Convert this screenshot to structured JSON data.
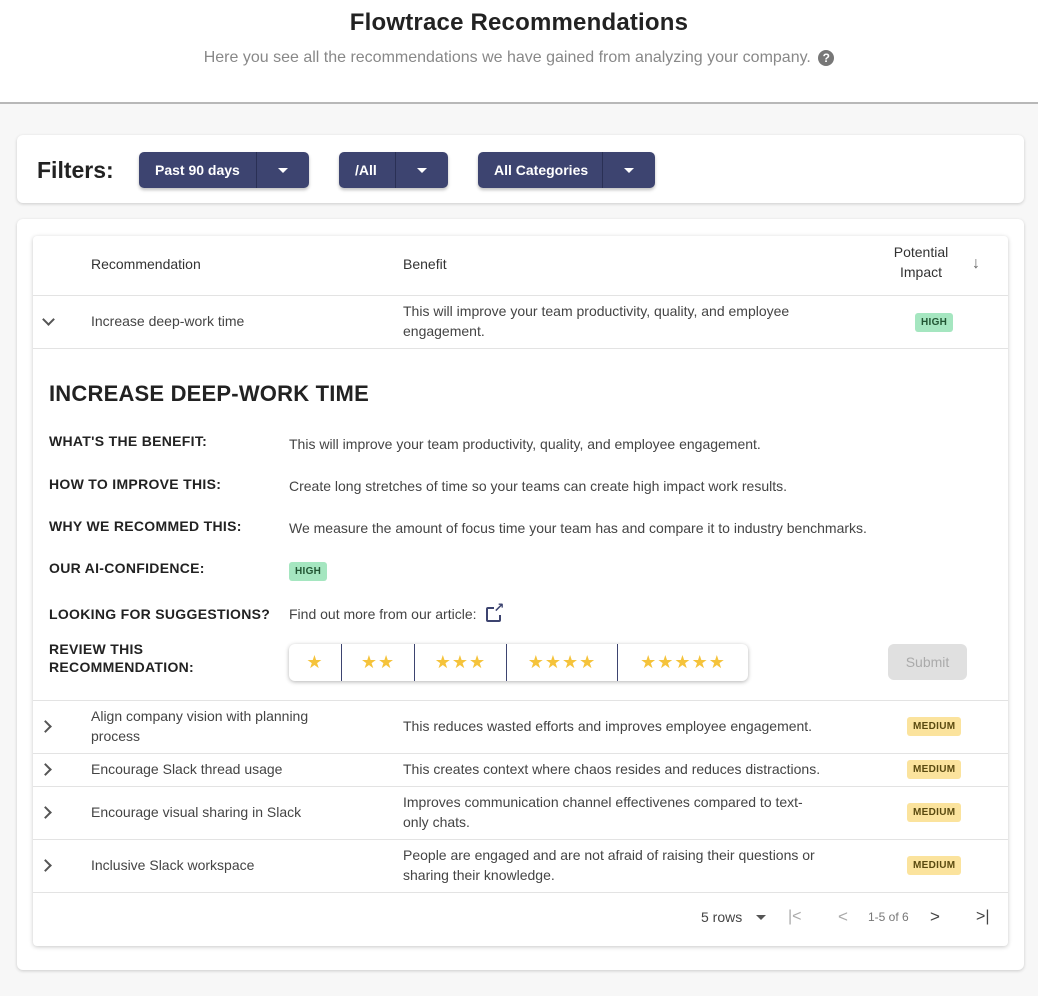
{
  "header": {
    "title": "Flowtrace Recommendations",
    "subtitle": "Here you see all the recommendations we have gained from analyzing your company.",
    "help_glyph": "?"
  },
  "filters": {
    "label": "Filters:",
    "period": "Past 90 days",
    "scope": "/All",
    "category": "All Categories"
  },
  "table": {
    "columns": {
      "recommendation": "Recommendation",
      "benefit": "Benefit",
      "impact_line1": "Potential",
      "impact_line2": "Impact",
      "sort_glyph": "↓"
    },
    "rows": [
      {
        "recommendation": "Increase deep-work time",
        "benefit": "This will improve your team productivity, quality, and employee engagement.",
        "impact": "HIGH",
        "expanded": true
      },
      {
        "recommendation": "Align company vision with planning process",
        "benefit": "This reduces wasted efforts and improves employee engagement.",
        "impact": "MEDIUM"
      },
      {
        "recommendation": "Encourage Slack thread usage",
        "benefit": "This creates context where chaos resides and reduces distractions.",
        "impact": "MEDIUM"
      },
      {
        "recommendation": "Encourage visual sharing in Slack",
        "benefit": "Improves communication channel effectivenes compared to text-only chats.",
        "impact": "MEDIUM"
      },
      {
        "recommendation": "Inclusive Slack workspace",
        "benefit": "People are engaged and are not afraid of raising their questions or sharing their knowledge.",
        "impact": "MEDIUM"
      }
    ]
  },
  "detail": {
    "title": "INCREASE DEEP-WORK TIME",
    "benefit_label": "WHAT'S THE BENEFIT:",
    "benefit_value": "This will improve your team productivity, quality, and employee engagement.",
    "improve_label": "HOW TO IMPROVE THIS:",
    "improve_value": "Create long stretches of time so your teams can create high impact work results.",
    "why_label": "WHY WE RECOMMED THIS:",
    "why_value": "We measure the amount of focus time your team has and compare it to industry benchmarks.",
    "confidence_label": "OUR AI-CONFIDENCE:",
    "confidence_value": "HIGH",
    "suggestions_label": "LOOKING FOR SUGGESTIONS?",
    "suggestions_value": "Find out more from our article:",
    "review_label_line1": "REVIEW THIS",
    "review_label_line2": "RECOMMENDATION:",
    "ratings": [
      "★",
      "★★",
      "★★★",
      "★★★★",
      "★★★★★"
    ],
    "submit_label": "Submit"
  },
  "pagination": {
    "rows_per_page": "5 rows",
    "range": "1-5 of 6",
    "first_glyph": "|<",
    "prev_glyph": "<",
    "next_glyph": ">",
    "last_glyph": ">|"
  },
  "colors": {
    "accent": "#3d4470",
    "high_badge": "#a5e6c0",
    "medium_badge": "#fbe39d",
    "star": "#f5c33b"
  }
}
